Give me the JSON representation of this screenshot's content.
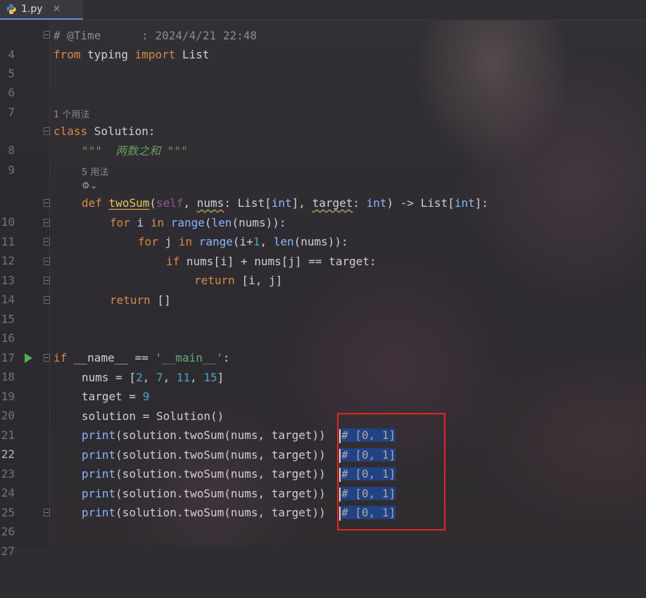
{
  "tab": {
    "label": "1.py",
    "close": "✕"
  },
  "hints": {
    "line8_usages": "1 个用法",
    "line10_usages": "5 用法",
    "ai_icon_glyph": "⚙⌄"
  },
  "lines": [
    {
      "n": "4",
      "code": "# @Time      : 2024/4/21 22:48"
    },
    {
      "n": "5",
      "code": "from typing import List"
    },
    {
      "n": "6",
      "code": ""
    },
    {
      "n": "7",
      "code": ""
    },
    {
      "n": "8",
      "code": "class Solution:"
    },
    {
      "n": "9",
      "code": "    \"\"\"  两数之和 \"\"\""
    },
    {
      "n": "10",
      "code": "    def twoSum(self, nums: List[int], target: int) -> List[int]:"
    },
    {
      "n": "11",
      "code": "        for i in range(len(nums)):"
    },
    {
      "n": "12",
      "code": "            for j in range(i+1, len(nums)):"
    },
    {
      "n": "13",
      "code": "                if nums[i] + nums[j] == target:"
    },
    {
      "n": "14",
      "code": "                    return [i, j]"
    },
    {
      "n": "15",
      "code": "        return []"
    },
    {
      "n": "16",
      "code": ""
    },
    {
      "n": "17",
      "code": ""
    },
    {
      "n": "18",
      "code": "if __name__ == '__main__':"
    },
    {
      "n": "19",
      "code": "    nums = [2, 7, 11, 15]"
    },
    {
      "n": "20",
      "code": "    target = 9"
    },
    {
      "n": "21",
      "code": "    solution = Solution()"
    },
    {
      "n": "22",
      "code": "    print(solution.twoSum(nums, target))  # [0, 1]"
    },
    {
      "n": "23",
      "code": "    print(solution.twoSum(nums, target))  # [0, 1]"
    },
    {
      "n": "24",
      "code": "    print(solution.twoSum(nums, target))  # [0, 1]"
    },
    {
      "n": "25",
      "code": "    print(solution.twoSum(nums, target))  # [0, 1]"
    },
    {
      "n": "26",
      "code": "    print(solution.twoSum(nums, target))  # [0, 1]"
    },
    {
      "n": "27",
      "code": ""
    }
  ],
  "tokens": {
    "hash_time": "# @Time      : 2024/4/21 22:48",
    "from": "from",
    "typing": " typing ",
    "import": "import",
    "List": " List",
    "class": "class",
    "Solution_def": " Solution:",
    "docstring": "\"\"\"  两数之和 \"\"\"",
    "def": "def",
    "twoSum": "twoSum",
    "self": "self",
    "nums_p": "nums",
    "colon_List_int": ": List[",
    "int": "int",
    "rb_comma": "], ",
    "target_p": "target",
    "colon_sp": ": ",
    "arrow": ") -> List[",
    "end_sig": "]:",
    "for": "for",
    "in": "in",
    "range": "range",
    "len": "len",
    "i": " i ",
    "j": " j ",
    "nums_paren": "nums",
    "plus1": "i+",
    "one": "1",
    "comma_sp": ", ",
    "if": "if",
    "cond": " nums[i] + nums[j] == target:",
    "return": "return",
    "ret_ij": " [i, j]",
    "ret_empty": " []",
    "if_main_name": "__name__",
    "eq": " == ",
    "main_str": "'__main__'",
    "nums_assign": "nums = [",
    "n2": "2",
    "n7": "7",
    "n11": "11",
    "n15": "15",
    "target_assign": "target = ",
    "n9": "9",
    "solution_assign": "solution = Solution()",
    "print": "print",
    "call": "(solution.twoSum(nums, target))",
    "comment": "# [0, 1]"
  }
}
